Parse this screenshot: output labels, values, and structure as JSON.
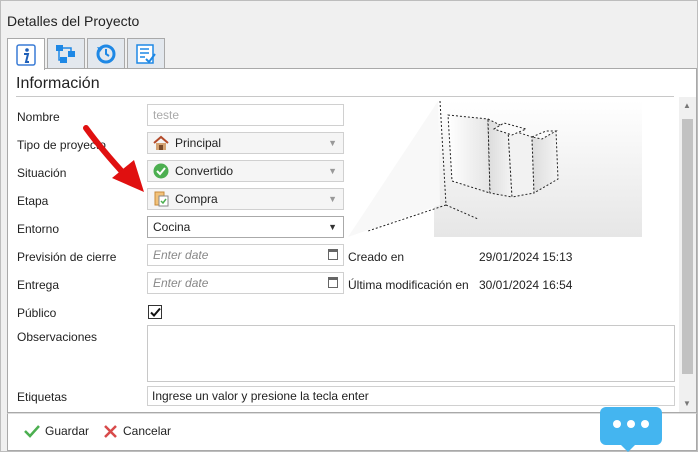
{
  "window": {
    "title": "Detalles del Proyecto"
  },
  "tabs": [
    {
      "icon": "info-icon",
      "active": true
    },
    {
      "icon": "hierarchy-icon",
      "active": false
    },
    {
      "icon": "history-icon",
      "active": false
    },
    {
      "icon": "checklist-icon",
      "active": false
    }
  ],
  "section": {
    "title": "Información"
  },
  "form": {
    "nombre": {
      "label": "Nombre",
      "placeholder": "teste"
    },
    "tipo": {
      "label": "Tipo de proyecto",
      "value": "Principal",
      "icon": "house-icon"
    },
    "situacion": {
      "label": "Situación",
      "value": "Convertido",
      "icon": "check-circle-icon"
    },
    "etapa": {
      "label": "Etapa",
      "value": "Compra",
      "icon": "document-icon"
    },
    "entorno": {
      "label": "Entorno",
      "value": "Cocina"
    },
    "prevision": {
      "label": "Previsión de cierre",
      "placeholder": "Enter date"
    },
    "entrega": {
      "label": "Entrega",
      "placeholder": "Enter date"
    },
    "publico": {
      "label": "Público",
      "checked": true
    },
    "observaciones": {
      "label": "Observaciones",
      "value": ""
    },
    "etiquetas": {
      "label": "Etiquetas",
      "placeholder": "Ingrese un valor y presione la tecla enter"
    }
  },
  "info": {
    "creado": {
      "label": "Creado en",
      "value": "29/01/2024 15:13"
    },
    "modificado": {
      "label": "Última modificación en",
      "value": "30/01/2024 16:54"
    }
  },
  "footer": {
    "save_label": "Guardar",
    "cancel_label": "Cancelar"
  },
  "colors": {
    "accent": "#1e88e5",
    "chat": "#44b5f0",
    "arrow": "#e01010",
    "check_green": "#4caf50"
  }
}
